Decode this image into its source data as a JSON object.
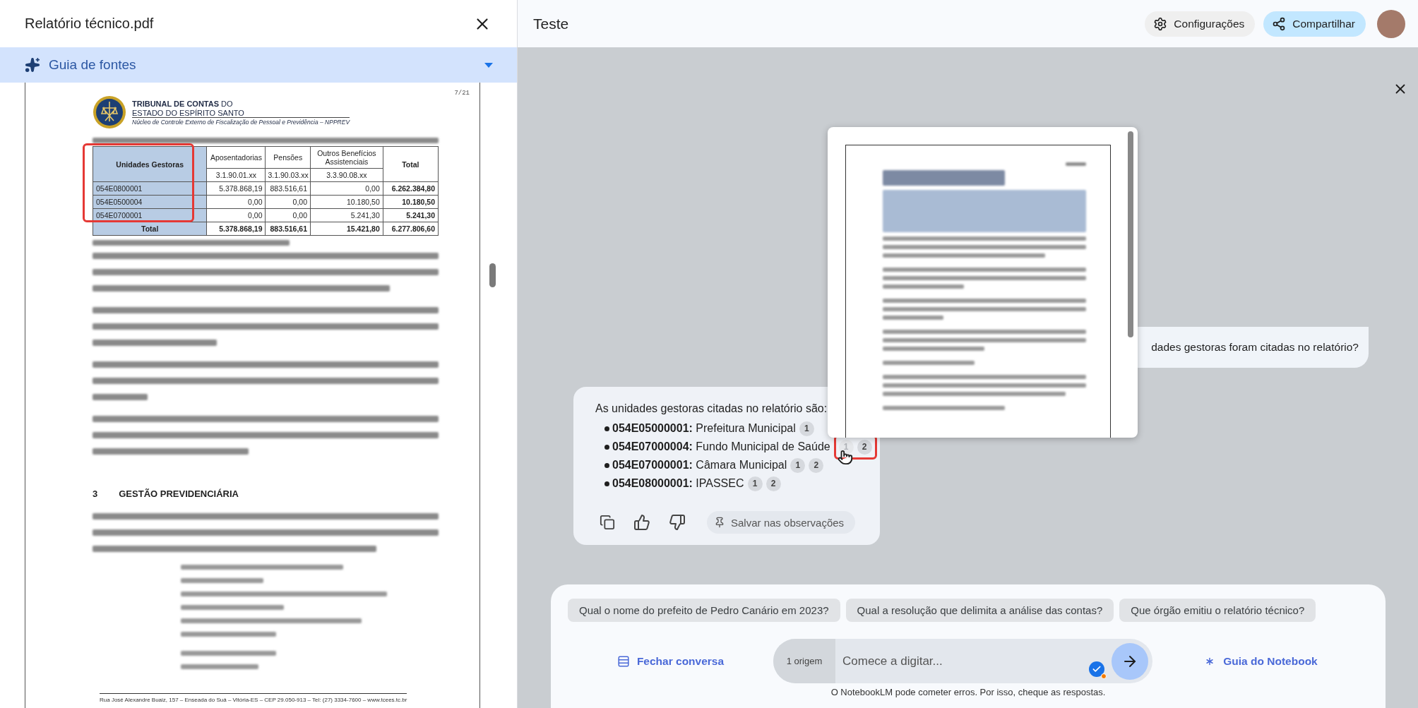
{
  "source_panel": {
    "title": "Relatório técnico.pdf",
    "guide_label": "Guia de fontes",
    "document": {
      "page_number": "7/21",
      "org_lines": [
        "**TRIBUNAL DE CONTAS** DO",
        "ESTADO DO ESPÍRITO SANTO",
        "Núcleo de Controle Externo de Fiscalização de Pessoal e Previdência – NPPREV"
      ],
      "table": {
        "columns": [
          {
            "label": "Unidades Gestoras"
          },
          {
            "label": "Aposentadorias",
            "code": "3.1.90.01.xx"
          },
          {
            "label": "Pensões",
            "code": "3.1.90.03.xx"
          },
          {
            "label": "Outros Benefícios Assistenciais",
            "code": "3.3.90.08.xx"
          },
          {
            "label": "Total"
          }
        ],
        "rows": [
          [
            "054E0800001",
            "5.378.868,19",
            "883.516,61",
            "0,00",
            "6.262.384,80"
          ],
          [
            "054E0500004",
            "0,00",
            "0,00",
            "10.180,50",
            "10.180,50"
          ],
          [
            "054E0700001",
            "0,00",
            "0,00",
            "5.241,30",
            "5.241,30"
          ]
        ],
        "total": [
          "Total",
          "5.378.868,19",
          "883.516,61",
          "15.421,80",
          "6.277.806,60"
        ]
      },
      "section": {
        "number": "3",
        "title": "GESTÃO PREVIDENCIÁRIA"
      },
      "footer": "Rua José Alexandre Buaiz, 157 – Enseada do Suá – Vitória-ES – CEP 29.050-913 – Tel: (27) 3334-7600 – www.tcees.tc.br"
    }
  },
  "chat_panel": {
    "title": "Teste",
    "buttons": [
      {
        "kind": "settings",
        "label": "Configurações"
      },
      {
        "kind": "share",
        "label": "Compartilhar"
      }
    ],
    "user_message": "dades gestoras foram citadas no relatório?",
    "answer": {
      "intro": "As unidades gestoras citadas no relatório são:",
      "items": [
        {
          "code": "054E05000001:",
          "name": "Prefeitura Municipal",
          "citations": [
            {
              "label": "1",
              "selected": false
            }
          ]
        },
        {
          "code": "054E07000004:",
          "name": "Fundo Municipal de Saúde",
          "citations": [
            {
              "label": "1",
              "selected": true
            },
            {
              "label": "2",
              "selected": false
            }
          ]
        },
        {
          "code": "054E07000001:",
          "name": "Câmara Municipal",
          "citations": [
            {
              "label": "1",
              "selected": false
            },
            {
              "label": "2",
              "selected": false
            }
          ]
        },
        {
          "code": "054E08000001:",
          "name": "IPASSEC",
          "citations": [
            {
              "label": "1",
              "selected": false
            },
            {
              "label": "2",
              "selected": false
            }
          ]
        }
      ],
      "save_label": "Salvar nas observações"
    },
    "suggestions": [
      "Qual o nome do prefeito de Pedro Canário em 2023?",
      "Qual a resolução que delimita a análise das contas?",
      "Que órgão emitiu o relatório técnico?"
    ],
    "close_chat": "Fechar conversa",
    "source_count": "1 origem",
    "input_placeholder": "Comece a digitar...",
    "guide_link": "Guia do Notebook",
    "disclaimer": "O NotebookLM pode cometer erros. Por isso, cheque as respostas."
  }
}
